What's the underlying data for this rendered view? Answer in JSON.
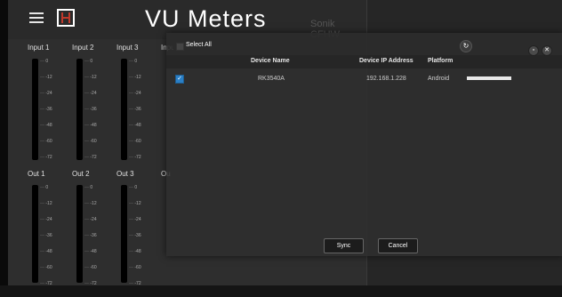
{
  "app": {
    "title": "VU Meters",
    "section": "Sonik CFHW"
  },
  "meter_scale": [
    "0",
    "-12",
    "-24",
    "-36",
    "-48",
    "-60",
    "-72"
  ],
  "inputs": [
    "Input 1",
    "Input 2",
    "Input 3",
    "Inpu"
  ],
  "outputs": [
    "Out 1",
    "Out 2",
    "Out 3",
    "Ou"
  ],
  "dialog": {
    "select_all_label": "Select All",
    "refresh_icon": "↻",
    "minimize_icon": "▫",
    "close_icon": "✕",
    "columns": {
      "name": "Device Name",
      "ip": "Device IP Address",
      "platform": "Platform"
    },
    "devices": [
      {
        "checked": true,
        "checkmark": "✓",
        "name": "RK3540A",
        "ip": "192.168.1.228",
        "platform": "Android",
        "progress": 1.0
      }
    ],
    "sync_label": "Sync",
    "cancel_label": "Cancel"
  },
  "colors": {
    "accent": "#2a7fc6",
    "logo_red": "#c0392b"
  }
}
